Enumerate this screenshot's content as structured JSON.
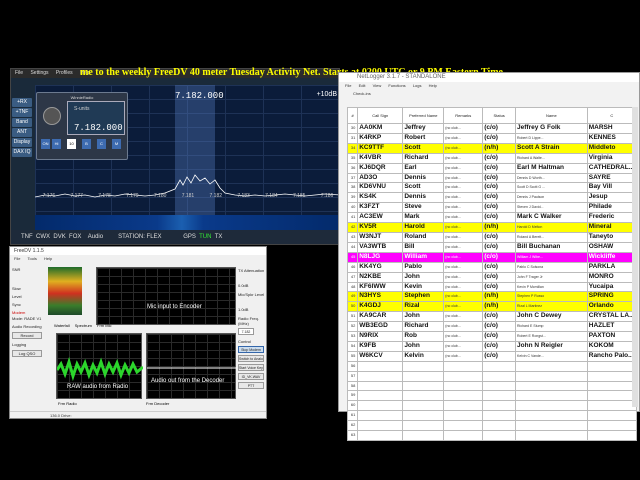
{
  "ticker": {
    "text": "me to the weekly FreeDV 40 meter Tuesday Activity Net.   Starts at 0200 UTC or 9 PM Eastern Time,"
  },
  "sdr": {
    "menu": [
      "File",
      "Settings",
      "Profiles",
      "Help"
    ],
    "side_buttons": [
      "+RX",
      "+TNF",
      "Band",
      "ANT",
      "Display",
      "DAX IQ"
    ],
    "freq": "7.182.000",
    "db_top": "+10dB",
    "ticks": [
      "7.176",
      "7.177",
      "7.178",
      "7.179",
      "7.180",
      "7.181",
      "7.182",
      "7.183",
      "7.184",
      "7.185",
      "7.186"
    ],
    "status": {
      "tnf": "TNF",
      "cwx": "CWX",
      "dvk": "DVK",
      "fox": "FOX",
      "audio": "Audio",
      "station": "STATION: FLEX",
      "gps": "GPS",
      "tun": "TUN",
      "tx": "TX"
    },
    "radio": {
      "title": "WinnieRadio",
      "freq": "7.182.000",
      "meter": "S-units",
      "buttons": [
        "ON",
        "Hi",
        "10",
        "B",
        "C",
        "M"
      ]
    }
  },
  "freedv": {
    "title": "FreeDV 1.1.5",
    "menu": [
      "File",
      "Tools",
      "Help"
    ],
    "left": {
      "snr": "SNR",
      "slow": "Slow",
      "level": "Level",
      "sync": "Sync",
      "modem": "Modem",
      "mode": "Mode: RADE V1",
      "audio_recording": "Audio Recording",
      "record": "Record",
      "logging": "Logging",
      "log_qso": "Log QSO"
    },
    "panels": {
      "mic": "Mic input to Encoder",
      "raw": "RAW audio from Radio",
      "decoder": "Audio out from the Decoder"
    },
    "tabs_top": [
      "Waterfall",
      "Spectrum",
      "Frm Mic"
    ],
    "tabs_bottom_left": [
      "Frm Radio"
    ],
    "tabs_bottom_right": [
      "Frm Decoder"
    ],
    "right": {
      "tx_atten": "TX Attenuation",
      "tx_atten_val": "0.0dB",
      "mic_spk": "Mic/Spkr Level",
      "mic_val": "1.0dB",
      "radio_freq": "Radio Freq. (MHz)",
      "radio_freq_val": "7.182",
      "control": "Control",
      "stop": "Stop Modem",
      "switch": "Switch to Analog",
      "start_voice": "Start Voice Keyer",
      "voice_file": "ID_VK.WAV",
      "ptt": "PTT"
    },
    "status": "136.0    Drive:"
  },
  "log": {
    "title": "NetLogger 3.1.7 - STANDALONE",
    "menu": [
      "File",
      "Edit",
      "View",
      "Functions",
      "Logs",
      "Help"
    ],
    "tab": "Check-ins",
    "headers": [
      "#",
      "Call Sign",
      "Preferred Name",
      "Remarks",
      "Status",
      "Name",
      "C"
    ],
    "rows": [
      {
        "n": "30",
        "call": "AA0KM",
        "pref": "Jeffrey",
        "rem": "(no club...",
        "st": "(c/o)",
        "name": "Jeffrey G Folk",
        "city": "MARSH",
        "hl": ""
      },
      {
        "n": "31",
        "call": "K4RKP",
        "pref": "Robert",
        "rem": "(no club...",
        "st": "(c/o)",
        "name": "Robert D Lippe...",
        "city": "KENNES",
        "hl": ""
      },
      {
        "n": "34",
        "call": "KC9TTF",
        "pref": "Scott",
        "rem": "(no club...",
        "st": "(n/h)",
        "name": "Scott A Strain",
        "city": "Middleto",
        "hl": "yel"
      },
      {
        "n": "35",
        "call": "K4VBR",
        "pref": "Richard",
        "rem": "(no club...",
        "st": "(c/o)",
        "name": "Richard A Walte...",
        "city": "Virginia",
        "hl": ""
      },
      {
        "n": "36",
        "call": "KJ6DQR",
        "pref": "Earl",
        "rem": "(no club...",
        "st": "(c/o)",
        "name": "Earl M Haltman",
        "city": "CATHEDRAL...",
        "hl": ""
      },
      {
        "n": "37",
        "call": "AD3O",
        "pref": "Dennis",
        "rem": "(no club...",
        "st": "(c/o)",
        "name": "Dennis D Worth...",
        "city": "SAYRE",
        "hl": ""
      },
      {
        "n": "38",
        "call": "KD6VNU",
        "pref": "Scott",
        "rem": "(no club...",
        "st": "(c/o)",
        "name": "Scott D Scott G ...",
        "city": "Bay Vill",
        "hl": ""
      },
      {
        "n": "39",
        "call": "KS4K",
        "pref": "Dennis",
        "rem": "(no club...",
        "st": "(c/o)",
        "name": "Dennis J Paulson",
        "city": "Jesup",
        "hl": ""
      },
      {
        "n": "40",
        "call": "K3FZT",
        "pref": "Steve",
        "rem": "(no club...",
        "st": "(c/o)",
        "name": "Steven J David...",
        "city": "Philade",
        "hl": ""
      },
      {
        "n": "41",
        "call": "AC3EW",
        "pref": "Mark",
        "rem": "(no club...",
        "st": "(c/o)",
        "name": "Mark C Walker",
        "city": "Frederic",
        "hl": ""
      },
      {
        "n": "42",
        "call": "KV5R",
        "pref": "Harold",
        "rem": "(no club...",
        "st": "(n/h)",
        "name": "Harold D Melton",
        "city": "Mineral",
        "hl": "yel"
      },
      {
        "n": "43",
        "call": "W3NJT",
        "pref": "Roland",
        "rem": "(no club...",
        "st": "(c/o)",
        "name": "Roland A Bereit...",
        "city": "Taneyto",
        "hl": ""
      },
      {
        "n": "44",
        "call": "VA3WTB",
        "pref": "Bill",
        "rem": "(no club...",
        "st": "(c/o)",
        "name": "Bill Buchanan",
        "city": "OSHAW",
        "hl": ""
      },
      {
        "n": "45",
        "call": "N8LJG",
        "pref": "William",
        "rem": "(no club...",
        "st": "(c/o)",
        "name": "William J Wibe...",
        "city": "Wickliffe",
        "hl": "mag"
      },
      {
        "n": "46",
        "call": "KK4YG",
        "pref": "Pablo",
        "rem": "(no club...",
        "st": "(c/o)",
        "name": "Pablo C Solsona",
        "city": "PARKLA",
        "hl": ""
      },
      {
        "n": "47",
        "call": "N2KBE",
        "pref": "John",
        "rem": "(no club...",
        "st": "(c/o)",
        "name": "John F Trager Jr",
        "city": "MONRO",
        "hl": ""
      },
      {
        "n": "48",
        "call": "KF6IWW",
        "pref": "Kevin",
        "rem": "(no club...",
        "st": "(c/o)",
        "name": "Kevin P Mcmillan",
        "city": "Yucaipa",
        "hl": ""
      },
      {
        "n": "49",
        "call": "N3HYS",
        "pref": "Stephen",
        "rem": "(no club...",
        "st": "(n/h)",
        "name": "Stephen P Russo",
        "city": "SPRING",
        "hl": "yel"
      },
      {
        "n": "50",
        "call": "K4GDJ",
        "pref": "Rizal",
        "rem": "(no club...",
        "st": "(n/h)",
        "name": "Rizal L Martinez",
        "city": "Orlando",
        "hl": "yel"
      },
      {
        "n": "51",
        "call": "KA9CAR",
        "pref": "John",
        "rem": "(no club...",
        "st": "(c/o)",
        "name": "John C Dewey",
        "city": "CRYSTAL LA...",
        "hl": ""
      },
      {
        "n": "52",
        "call": "WB3EGD",
        "pref": "Richard",
        "rem": "(no club...",
        "st": "(c/o)",
        "name": "Richard E Stump",
        "city": "HAZLET",
        "hl": ""
      },
      {
        "n": "53",
        "call": "N9RIX",
        "pref": "Rob",
        "rem": "(no club...",
        "st": "(c/o)",
        "name": "Robert E Rongst...",
        "city": "PAXTON",
        "hl": ""
      },
      {
        "n": "54",
        "call": "K9FB",
        "pref": "John",
        "rem": "(no club...",
        "st": "(c/o)",
        "name": "John N Reigler",
        "city": "KOKOM",
        "hl": ""
      },
      {
        "n": "55",
        "call": "W6KCV",
        "pref": "Kelvin",
        "rem": "(no club...",
        "st": "(c/o)",
        "name": "Kelvin C Vande...",
        "city": "Rancho Palo...",
        "hl": ""
      }
    ],
    "empty_rows": [
      "56",
      "57",
      "58",
      "59",
      "60",
      "61",
      "62",
      "63"
    ]
  }
}
